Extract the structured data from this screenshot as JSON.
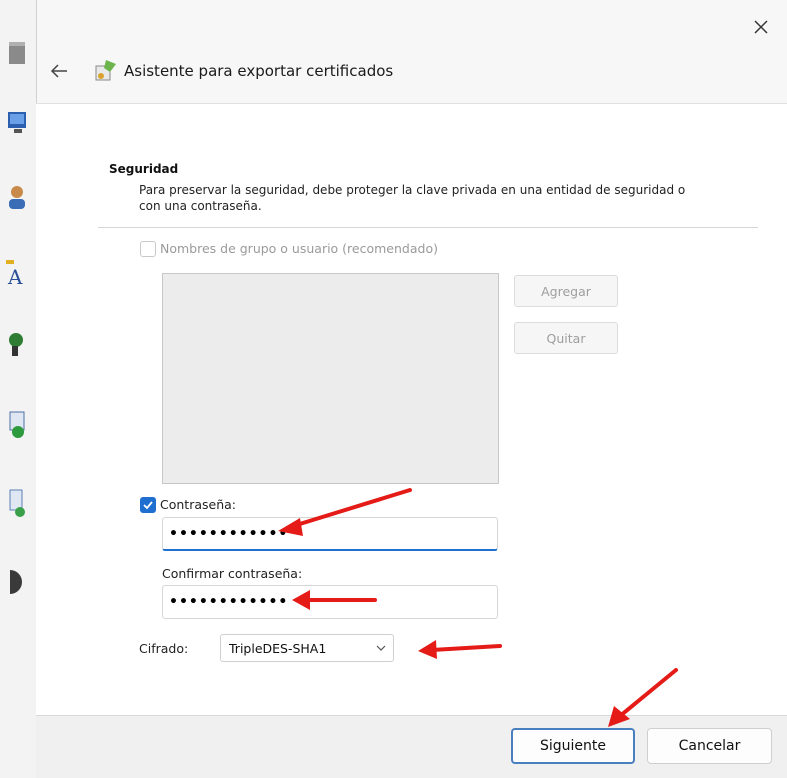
{
  "window": {
    "title": "Asistente para exportar certificados"
  },
  "security": {
    "heading": "Seguridad",
    "description": "Para preservar la seguridad, debe proteger la clave privada en una entidad de seguridad o con una contraseña.",
    "group_option": {
      "label": "Nombres de grupo o usuario (recomendado)",
      "checked": false,
      "enabled": false
    },
    "buttons": {
      "add": "Agregar",
      "remove": "Quitar"
    },
    "password_option": {
      "label": "Contraseña:",
      "checked": true,
      "value": "••••••••••••"
    },
    "confirm": {
      "label": "Confirmar contraseña:",
      "value": "••••••••••••"
    },
    "encryption": {
      "label": "Cifrado:",
      "selected": "TripleDES-SHA1"
    }
  },
  "footer": {
    "next": "Siguiente",
    "cancel": "Cancelar"
  },
  "colors": {
    "accent": "#1e6fd0",
    "annotation": "#e41b17"
  },
  "icons": {
    "close": "close-icon",
    "back": "back-arrow-icon",
    "wizard": "certificate-wizard-icon",
    "dropdown": "chevron-down-icon",
    "check": "checkmark-icon"
  }
}
